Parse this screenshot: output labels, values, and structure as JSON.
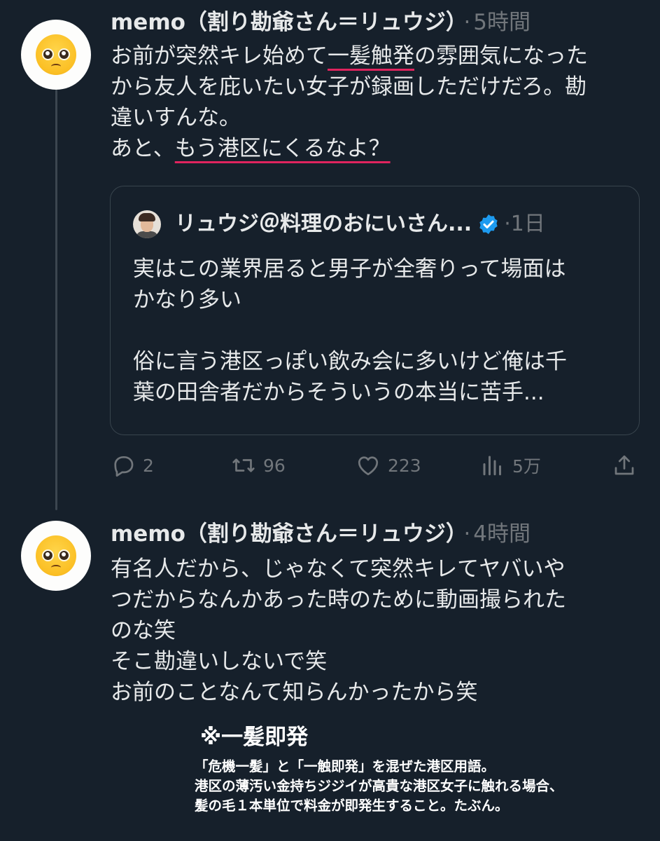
{
  "tweet1": {
    "author": "memo（割り勘爺さん＝リュウジ）",
    "dot": "·",
    "time": "5時間",
    "lines": [
      {
        "pre": "お前が突然キレ始めて",
        "ul": "一髪触発",
        "post": "の雰囲気になった"
      },
      {
        "pre": "から友人を庇いたい女子が録画しただけだろ。勘",
        "ul": "",
        "post": ""
      },
      {
        "pre": "違いすんな。",
        "ul": "",
        "post": ""
      },
      {
        "pre": "あと、",
        "ul": "もう港区にくるなよ？",
        "post": ""
      }
    ]
  },
  "quote": {
    "author": "リュウジ＠料理のおにいさん...",
    "dot": "·",
    "time": "1日",
    "lines": [
      "実はこの業界居ると男子が全奢りって場面は",
      "かなり多い",
      "",
      "俗に言う港区っぽい飲み会に多いけど俺は千",
      "葉の田舎者だからそういうの本当に苦手..."
    ]
  },
  "actions": {
    "replies": "2",
    "retweets": "96",
    "likes": "223",
    "views": "5万"
  },
  "tweet2": {
    "author": "memo（割り勘爺さん＝リュウジ）",
    "dot": "·",
    "time": "4時間",
    "lines": [
      "有名人だから、じゃなくて突然キレてヤバいや",
      "つだからなんかあった時のために動画撮られた",
      "のな笑",
      "そこ勘違いしないで笑",
      "お前のことなんて知らんかったから笑"
    ]
  },
  "annotation": {
    "title": "※一髪即発",
    "lines": [
      "「危機一髪」と「一触即発」を混ぜた港区用語。",
      "港区の薄汚い金持ちジジイが高貴な港区女子に触れる場合、",
      "髪の毛１本単位で料金が即発生すること。たぶん。"
    ]
  },
  "colors": {
    "background": "#16202b",
    "text": "#e7e9ea",
    "muted": "#71767b",
    "underline": "#e0245e",
    "verified": "#1d9bf0"
  },
  "icons": {
    "reply": "reply-icon",
    "retweet": "retweet-icon",
    "like": "heart-icon",
    "views": "views-icon",
    "share": "share-icon",
    "verified": "verified-badge-icon",
    "avatar": "pleading-face-emoji"
  }
}
